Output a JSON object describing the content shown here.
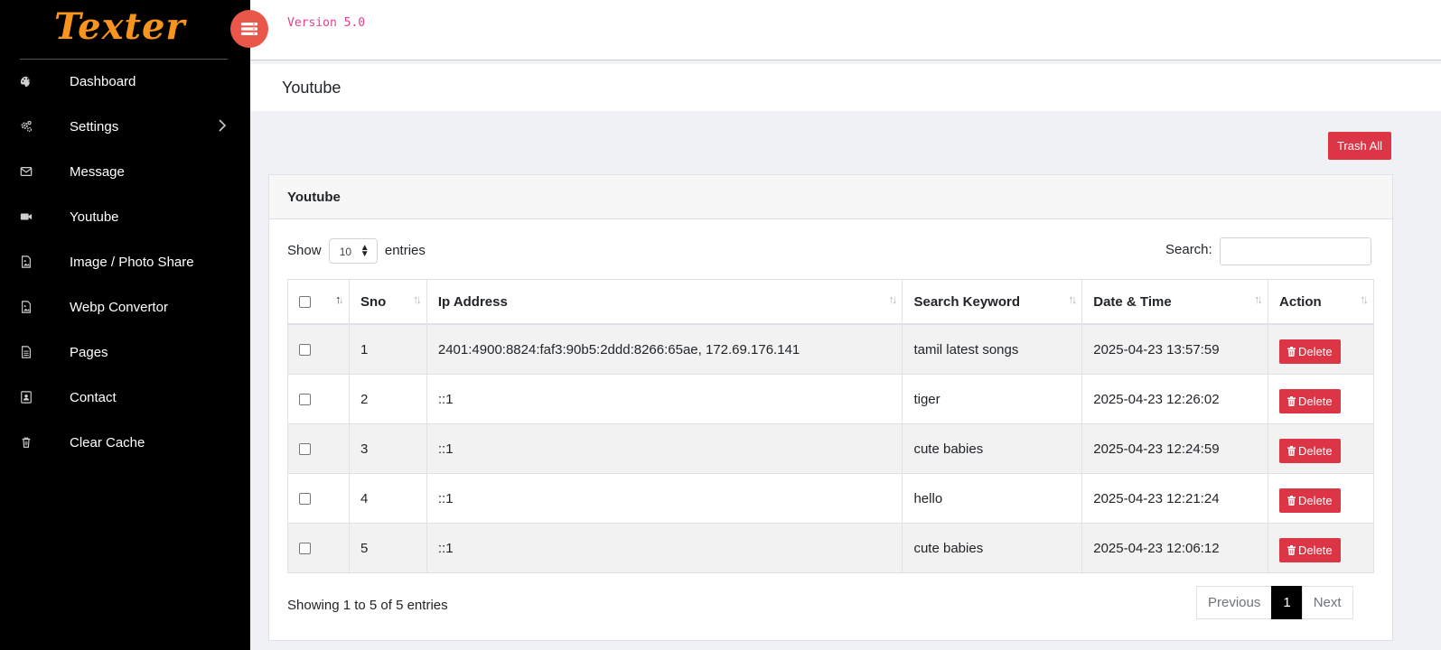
{
  "brand": {
    "logo_text": "Texter",
    "version": "Version 5.0",
    "accent": "#e8574a",
    "logo_color": "#f7941d"
  },
  "sidebar": {
    "items": [
      {
        "label": "Dashboard",
        "icon": "palette-icon"
      },
      {
        "label": "Settings",
        "icon": "cogs-icon",
        "has_submenu": true
      },
      {
        "label": "Message",
        "icon": "envelope-icon"
      },
      {
        "label": "Youtube",
        "icon": "video-camera-icon"
      },
      {
        "label": "Image / Photo Share",
        "icon": "image-file-icon"
      },
      {
        "label": "Webp Convertor",
        "icon": "image-file-icon"
      },
      {
        "label": "Pages",
        "icon": "document-icon"
      },
      {
        "label": "Contact",
        "icon": "contact-card-icon"
      },
      {
        "label": "Clear Cache",
        "icon": "trash-icon"
      }
    ]
  },
  "page": {
    "title": "Youtube",
    "trash_all_label": "Trash All"
  },
  "card": {
    "title": "Youtube",
    "show_label": "Show",
    "entries_label": "entries",
    "page_length": "10",
    "search_label": "Search:",
    "search_value": ""
  },
  "table": {
    "columns": [
      "",
      "Sno",
      "Ip Address",
      "Search Keyword",
      "Date & Time",
      "Action"
    ],
    "delete_label": "Delete",
    "rows": [
      {
        "sno": "1",
        "ip": "2401:4900:8824:faf3:90b5:2ddd:8266:65ae, 172.69.176.141",
        "keyword": "tamil latest songs",
        "datetime": "2025-04-23 13:57:59"
      },
      {
        "sno": "2",
        "ip": "::1",
        "keyword": "tiger",
        "datetime": "2025-04-23 12:26:02"
      },
      {
        "sno": "3",
        "ip": "::1",
        "keyword": "cute babies",
        "datetime": "2025-04-23 12:24:59"
      },
      {
        "sno": "4",
        "ip": "::1",
        "keyword": "hello",
        "datetime": "2025-04-23 12:21:24"
      },
      {
        "sno": "5",
        "ip": "::1",
        "keyword": "cute babies",
        "datetime": "2025-04-23 12:06:12"
      }
    ]
  },
  "footer": {
    "info": "Showing 1 to 5 of 5 entries",
    "previous_label": "Previous",
    "current_page": "1",
    "next_label": "Next"
  }
}
